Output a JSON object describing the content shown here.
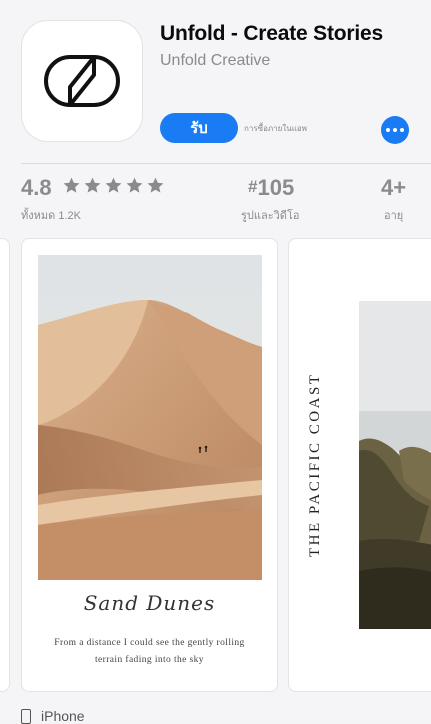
{
  "app": {
    "title": "Unfold - Create Stories",
    "developer": "Unfold Creative",
    "get_label": "รับ",
    "iap_note": "การซื้อภายในแอพ"
  },
  "stats": {
    "rating": "4.8",
    "stars": 5,
    "rating_count": "ทั้งหมด 1.2K",
    "rank": "105",
    "rank_hash": "#",
    "rank_category": "รูปและวิดีโอ",
    "age": "4+",
    "age_label": "อายุ"
  },
  "screenshots": [
    {
      "caption_title": "Sand Dunes",
      "caption_body": "From a distance I could see the gently rolling terrain fading into the sky"
    },
    {
      "vertical_title": "THE PACIFIC COAST"
    }
  ],
  "device": {
    "label": "iPhone"
  },
  "colors": {
    "accent": "#1a7cf5",
    "gray_text": "#8a8a8f"
  }
}
